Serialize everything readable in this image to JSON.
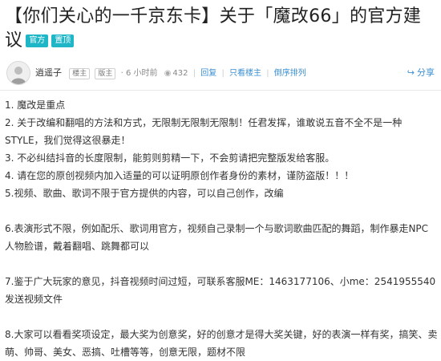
{
  "post": {
    "title": "【你们关心的一千京东卡】关于「魔改66」的官方建议",
    "badges": [
      "官方",
      "置顶"
    ]
  },
  "meta": {
    "author": "逍遥子",
    "tags": [
      "楼主",
      "版主"
    ],
    "time": "6 小时前",
    "views": "432",
    "reply_label": "回复",
    "only_author_label": "只看楼主",
    "sort_label": "倒序排列",
    "share_label": "分享"
  },
  "content": {
    "lines": [
      "1. 魔改是重点",
      "2. 关于改编和翻唱的方法和方式，无限制无限制无限制！任君发挥，谁敢说五音不全不是一种STYLE，我们觉得这很暴走！",
      "3. 不必纠结抖音的长度限制，能剪则剪精一下，不会剪请把完整版发给客服。",
      "4. 请在您的原创视频内加入适量的可以证明原创作者身份的素材，谨防盗版！！！",
      "5.视频、歌曲、歌词不限于官方提供的内容，可以自己创作，改编"
    ],
    "para6": "6.表演形式不限，例如配乐、歌词用官方，视频自己录制一个与歌词歌曲匹配的舞蹈，制作暴走NPC人物脸谱，戴着翻唱、跳舞都可以",
    "para7": "7.鉴于广大玩家的意见，抖音视频时间过短，可联系客服ME：1463177106、小me：2541955540发送视频文件",
    "para8": "8.大家可以看看奖项设定，最大奖为创意奖，好的创意才是得大奖关键，好的表演一样有奖，搞笑、卖萌、帅哥、美女、恶搞、吐槽等等，创意无限，题材不限"
  },
  "colors": {
    "accent": "#1fb6c8",
    "link": "#3a8fd1"
  },
  "icons": {
    "share": "share-icon",
    "views": "eye-icon"
  }
}
